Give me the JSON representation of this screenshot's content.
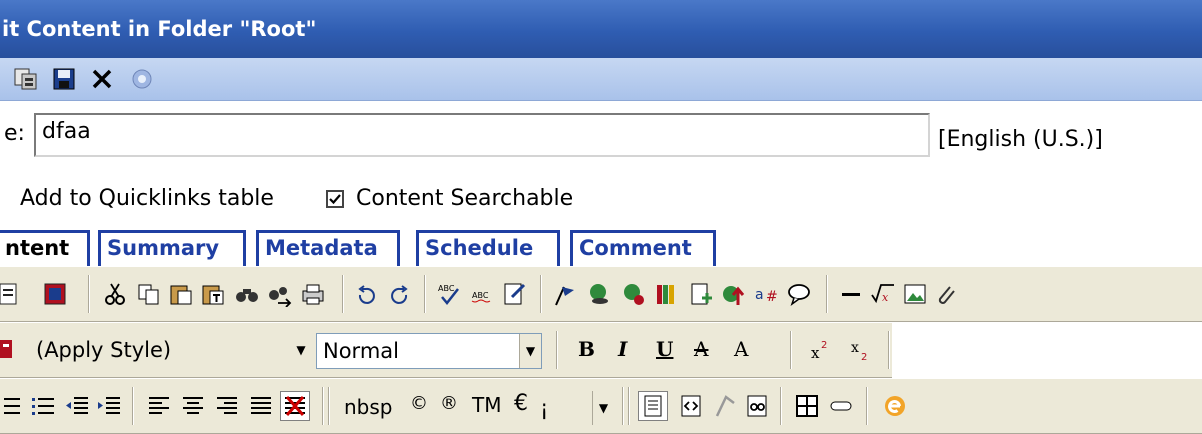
{
  "window": {
    "title": "it Content in Folder \"Root\""
  },
  "form": {
    "title_label": "e:",
    "title_value": "dfaa",
    "language": "[English (U.S.)]",
    "quicklinks_label": "Add to Quicklinks table",
    "searchable_label": "Content Searchable",
    "searchable_checked": true
  },
  "tabs": [
    {
      "label": "ntent",
      "active": true
    },
    {
      "label": "Summary",
      "active": false
    },
    {
      "label": "Metadata",
      "active": false
    },
    {
      "label": "Schedule",
      "active": false
    },
    {
      "label": "Comment",
      "active": false
    }
  ],
  "editor": {
    "style_select": "(Apply Style)",
    "format_select": "Normal",
    "special_chars": {
      "nbsp": "nbsp",
      "copyright": "©",
      "registered": "®",
      "trademark": "TM",
      "euro": "€",
      "char_select": "¡"
    },
    "format_buttons": {
      "bold": "B",
      "italic": "I",
      "underline": "U",
      "strike": "A",
      "font": "A"
    }
  },
  "colors": {
    "title_bar": "#2f5db2",
    "tab_border": "#1f3fa3",
    "toolbar_bg": "#ece9d8"
  }
}
